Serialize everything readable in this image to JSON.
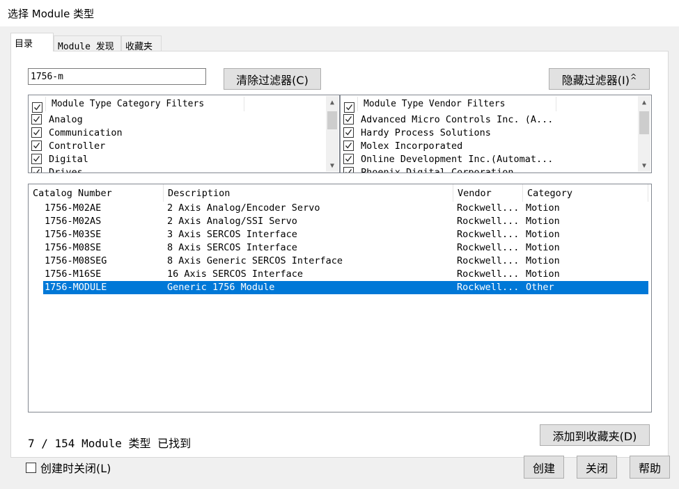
{
  "window": {
    "title": "选择 Module 类型"
  },
  "tabs": [
    {
      "label": "目录"
    },
    {
      "label": "Module 发现"
    },
    {
      "label": "收藏夹"
    }
  ],
  "search": {
    "value": "1756-m"
  },
  "buttons": {
    "clear_filters": "清除过滤器(C)",
    "hide_filters": "隐藏过滤器(I)",
    "add_favorites": "添加到收藏夹(D)",
    "create": "创建",
    "close": "关闭",
    "help": "帮助"
  },
  "category_filters": {
    "header": "Module Type Category Filters",
    "items": [
      {
        "label": "Analog",
        "checked": true
      },
      {
        "label": "Communication",
        "checked": true
      },
      {
        "label": "Controller",
        "checked": true
      },
      {
        "label": "Digital",
        "checked": true
      },
      {
        "label": "Drives",
        "checked": true
      }
    ]
  },
  "vendor_filters": {
    "header": "Module Type Vendor Filters",
    "items": [
      {
        "label": "Advanced Micro Controls Inc.  (A...",
        "checked": true
      },
      {
        "label": "Hardy Process Solutions",
        "checked": true
      },
      {
        "label": "Molex Incorporated",
        "checked": true
      },
      {
        "label": "Online Development Inc.(Automat...",
        "checked": true
      },
      {
        "label": "Phoenix Digital Corporation",
        "checked": true
      }
    ]
  },
  "table": {
    "columns": [
      "Catalog Number",
      "Description",
      "Vendor",
      "Category"
    ],
    "rows": [
      [
        "1756-M02AE",
        "2 Axis Analog/Encoder Servo",
        "Rockwell...",
        "Motion"
      ],
      [
        "1756-M02AS",
        "2 Axis Analog/SSI Servo",
        "Rockwell...",
        "Motion"
      ],
      [
        "1756-M03SE",
        "3 Axis SERCOS Interface",
        "Rockwell...",
        "Motion"
      ],
      [
        "1756-M08SE",
        "8 Axis SERCOS Interface",
        "Rockwell...",
        "Motion"
      ],
      [
        "1756-M08SEG",
        "8 Axis Generic SERCOS Interface",
        "Rockwell...",
        "Motion"
      ],
      [
        "1756-M16SE",
        "16 Axis SERCOS Interface",
        "Rockwell...",
        "Motion"
      ],
      [
        "1756-MODULE",
        "Generic 1756 Module",
        "Rockwell...",
        "Other"
      ]
    ],
    "selected_index": 6
  },
  "status": {
    "text": "7 / 154 Module 类型 已找到"
  },
  "close_on_create": {
    "label": "创建时关闭(L)",
    "checked": false
  },
  "colors": {
    "selection": "#0078d7",
    "background": "#f0f0f0"
  }
}
